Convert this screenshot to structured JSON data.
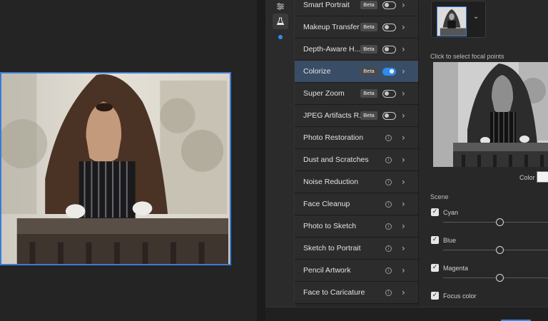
{
  "colors": {
    "accent": "#2d8cf0",
    "active_row": "#3a4d66",
    "panel_bg": "#282828",
    "canvas_bg": "#242424"
  },
  "rail": {
    "icons": [
      "sliders-icon",
      "flask-icon"
    ]
  },
  "filters": [
    {
      "label": "Smart Portrait",
      "badge": "Beta",
      "control": "toggle",
      "on": false
    },
    {
      "label": "Makeup Transfer",
      "badge": "Beta",
      "control": "toggle",
      "on": false
    },
    {
      "label": "Depth-Aware H...",
      "badge": "Beta",
      "control": "toggle",
      "on": false
    },
    {
      "label": "Colorize",
      "badge": "Beta",
      "control": "toggle",
      "on": true,
      "active": true
    },
    {
      "label": "Super Zoom",
      "badge": "Beta",
      "control": "toggle",
      "on": false
    },
    {
      "label": "JPEG Artifacts R...",
      "badge": "Beta",
      "control": "toggle",
      "on": false
    },
    {
      "label": "Photo Restoration",
      "control": "info"
    },
    {
      "label": "Dust and Scratches",
      "control": "info"
    },
    {
      "label": "Noise Reduction",
      "control": "info"
    },
    {
      "label": "Face Cleanup",
      "control": "info"
    },
    {
      "label": "Photo to Sketch",
      "control": "info"
    },
    {
      "label": "Sketch to Portrait",
      "control": "info"
    },
    {
      "label": "Pencil Artwork",
      "control": "info"
    },
    {
      "label": "Face to Caricature",
      "control": "info"
    }
  ],
  "settings": {
    "focal_label": "Click to select focal points",
    "color_label": "Color",
    "scene_label": "Scene",
    "sliders": [
      {
        "label": "Cyan",
        "checked": true,
        "value": 0.5
      },
      {
        "label": "Blue",
        "checked": true,
        "value": 0.5
      },
      {
        "label": "Magenta",
        "checked": true,
        "value": 0.5
      },
      {
        "label": "Focus color",
        "checked": true,
        "cutoff": "Se"
      }
    ]
  }
}
